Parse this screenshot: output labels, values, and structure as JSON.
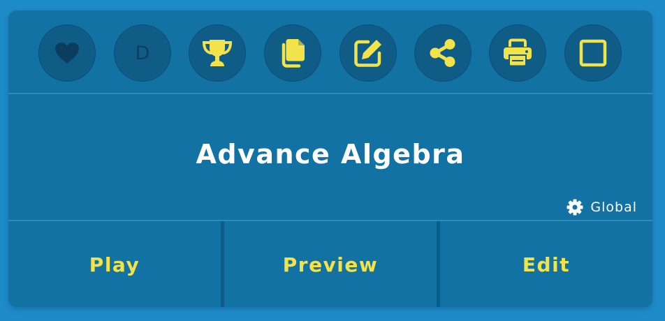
{
  "toolbar": {
    "items": [
      {
        "name": "favorite-button",
        "icon": "heart-icon",
        "color": "#0b3e5e"
      },
      {
        "name": "difficulty-button",
        "label": "D",
        "color": "#0b3e5e"
      },
      {
        "name": "trophy-button",
        "icon": "trophy-icon",
        "color": "#f2e34a"
      },
      {
        "name": "copy-button",
        "icon": "copy-icon",
        "color": "#f2e34a"
      },
      {
        "name": "edit-icon-button",
        "icon": "pencil-square-icon",
        "color": "#f2e34a"
      },
      {
        "name": "share-button",
        "icon": "share-icon",
        "color": "#f2e34a"
      },
      {
        "name": "print-button",
        "icon": "printer-icon",
        "color": "#f2e34a"
      },
      {
        "name": "select-button",
        "icon": "checkbox-icon",
        "color": "#f2e34a"
      }
    ]
  },
  "set": {
    "title": "Advance Algebra",
    "scope_label": "Global",
    "scope_icon": "gear-icon"
  },
  "actions": {
    "play_label": "Play",
    "preview_label": "Preview",
    "edit_label": "Edit"
  },
  "colors": {
    "background": "#1e8bc9",
    "card": "#1372a4",
    "accent": "#f2e34a",
    "title": "#ffffff"
  }
}
